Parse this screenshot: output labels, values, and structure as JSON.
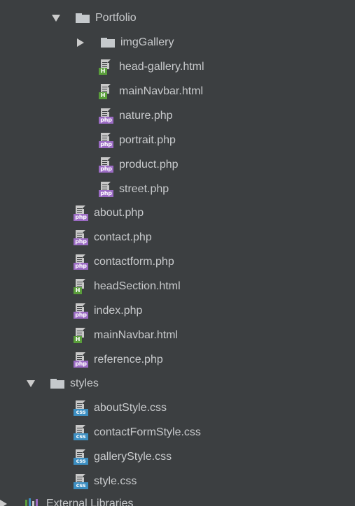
{
  "tree": {
    "portfolio": {
      "label": "Portfolio",
      "expanded": true,
      "children": [
        {
          "label": "imgGallery",
          "kind": "folder"
        },
        {
          "label": "head-gallery.html",
          "kind": "html",
          "badge": "H"
        },
        {
          "label": "mainNavbar.html",
          "kind": "html",
          "badge": "H"
        },
        {
          "label": "nature.php",
          "kind": "php",
          "badge": "php"
        },
        {
          "label": "portrait.php",
          "kind": "php",
          "badge": "php"
        },
        {
          "label": "product.php",
          "kind": "php",
          "badge": "php"
        },
        {
          "label": "street.php",
          "kind": "php",
          "badge": "php"
        }
      ]
    },
    "root_files": [
      {
        "label": "about.php",
        "kind": "php",
        "badge": "php"
      },
      {
        "label": "contact.php",
        "kind": "php",
        "badge": "php"
      },
      {
        "label": "contactform.php",
        "kind": "php",
        "badge": "php"
      },
      {
        "label": "headSection.html",
        "kind": "html",
        "badge": "H"
      },
      {
        "label": "index.php",
        "kind": "php",
        "badge": "php"
      },
      {
        "label": "mainNavbar.html",
        "kind": "html",
        "badge": "H"
      },
      {
        "label": "reference.php",
        "kind": "php",
        "badge": "php"
      }
    ],
    "styles": {
      "label": "styles",
      "expanded": true,
      "children": [
        {
          "label": "aboutStyle.css",
          "kind": "css",
          "badge": "css"
        },
        {
          "label": "contactFormStyle.css",
          "kind": "css",
          "badge": "css"
        },
        {
          "label": "galleryStyle.css",
          "kind": "css",
          "badge": "css"
        },
        {
          "label": "style.css",
          "kind": "css",
          "badge": "css"
        }
      ]
    },
    "external_libraries": {
      "label": "External Libraries"
    }
  },
  "colors": {
    "background": "#3c3f41",
    "text": "#c8cacc",
    "php_badge": "#9b6bc4",
    "html_badge": "#5a9e3b",
    "css_badge": "#3d8fc2"
  }
}
